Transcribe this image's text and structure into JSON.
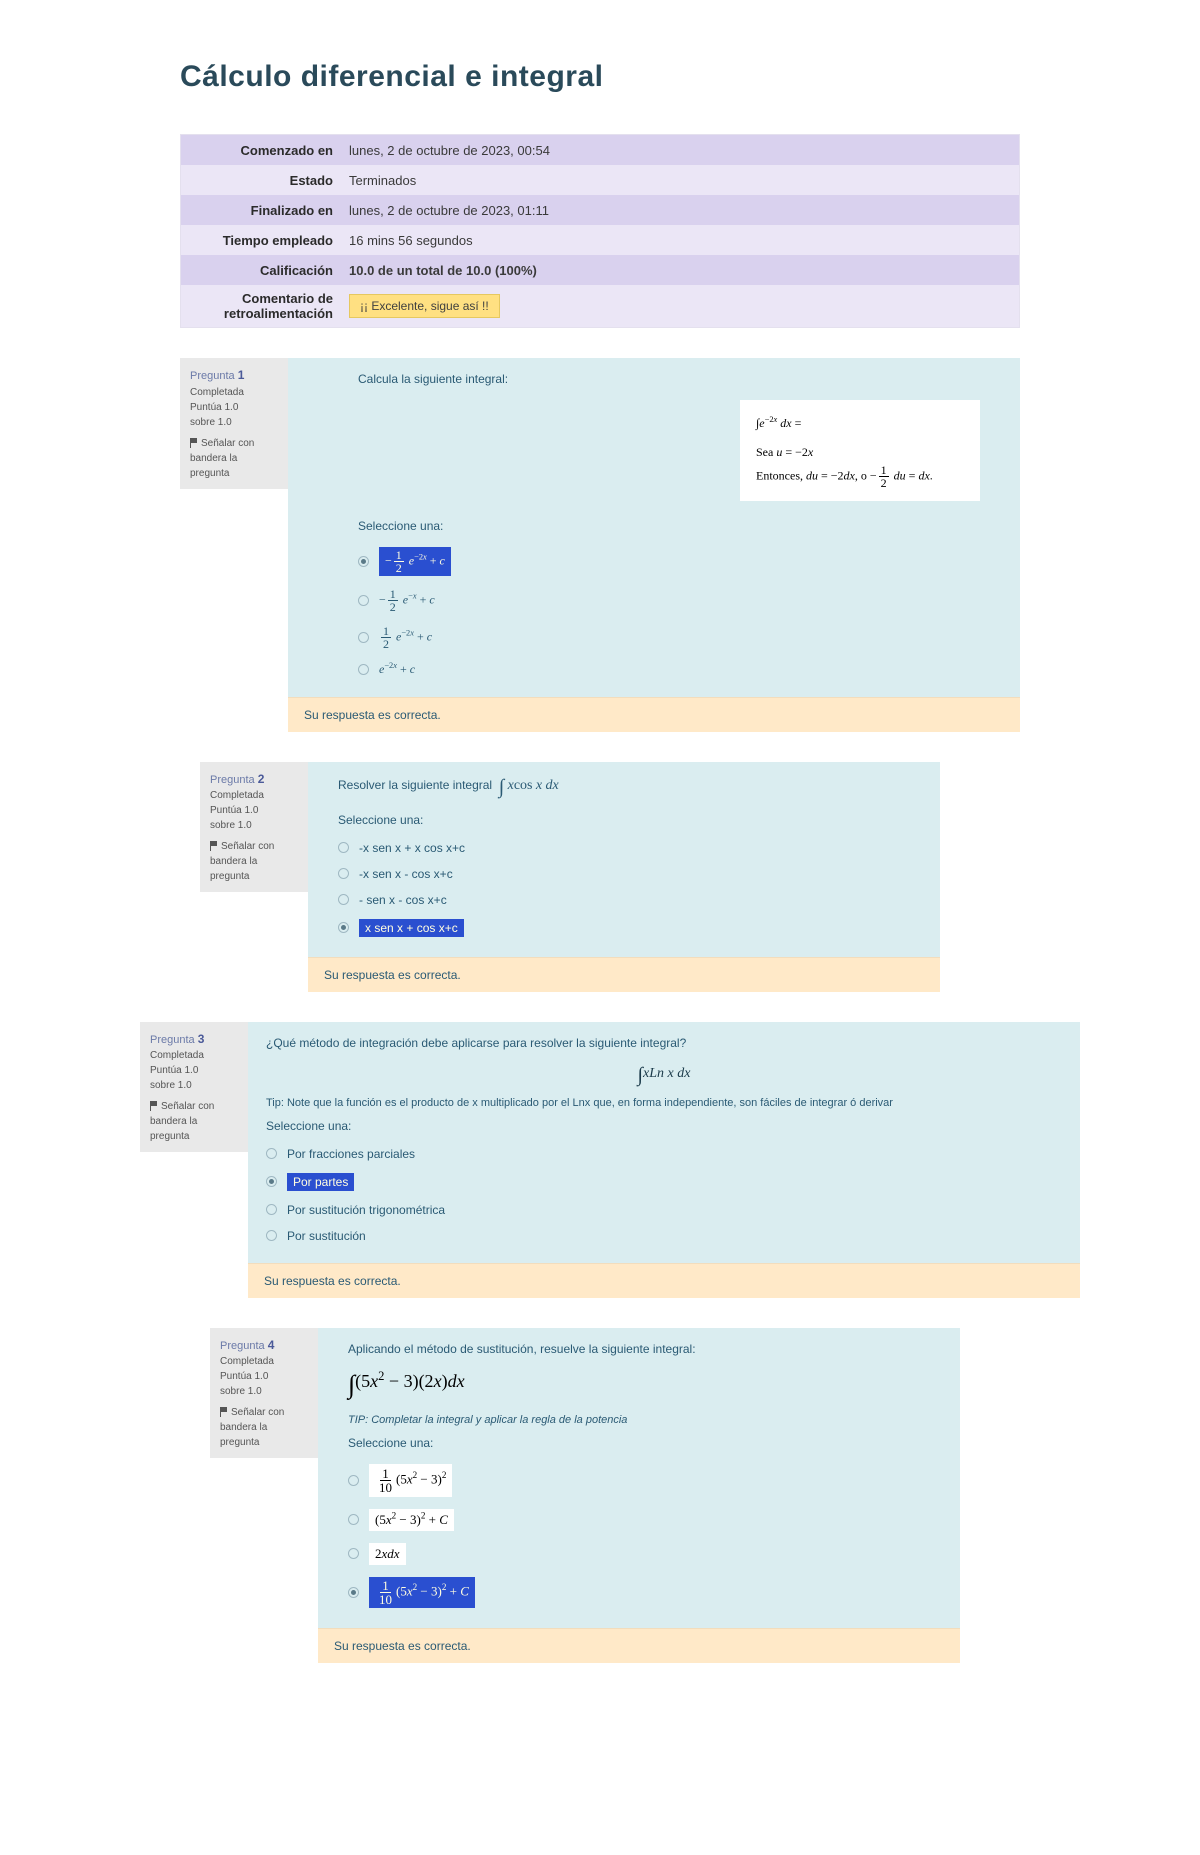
{
  "title": "Cálculo diferencial e integral",
  "summary": {
    "rows": [
      {
        "label": "Comenzado en",
        "value": "lunes, 2 de octubre de 2023, 00:54"
      },
      {
        "label": "Estado",
        "value": "Terminados"
      },
      {
        "label": "Finalizado en",
        "value": "lunes, 2 de octubre de 2023, 01:11"
      },
      {
        "label": "Tiempo empleado",
        "value": "16 mins 56 segundos"
      },
      {
        "label": "Calificación",
        "value": "10.0 de un total de 10.0 (100%)"
      }
    ],
    "feedback_label": "Comentario de retroalimentación",
    "feedback_text": "¡¡ Excelente, sigue así !!"
  },
  "common": {
    "question_word": "Pregunta",
    "completed": "Completada",
    "score_prefix": "Puntúa 1.0",
    "score_suffix": "sobre 1.0",
    "flag": "Señalar con bandera la pregunta",
    "select_one": "Seleccione una:",
    "correct": "Su respuesta es correcta."
  },
  "q1": {
    "num": "1",
    "prompt": "Calcula la siguiente integral:",
    "math": {
      "line1": "∫e^{-2x} dx =",
      "line2": "Sea u = −2x",
      "line3": "Entonces, du = −2dx, o −½ du = dx."
    },
    "options": [
      {
        "text": "−½ e^{−2x} + c",
        "selected": true,
        "highlight": true
      },
      {
        "text": "−½ e^{−x} + c",
        "selected": false,
        "highlight": false
      },
      {
        "text": "½ e^{−2x} + c",
        "selected": false,
        "highlight": false
      },
      {
        "text": "e^{−2x} + c",
        "selected": false,
        "highlight": false
      }
    ]
  },
  "q2": {
    "num": "2",
    "prompt_prefix": "Resolver la siguiente integral",
    "prompt_integral": "∫ xcos x dx",
    "options": [
      {
        "text": "-x sen x + x cos x+c",
        "selected": false,
        "highlight": false
      },
      {
        "text": "-x sen x - cos x+c",
        "selected": false,
        "highlight": false
      },
      {
        "text": "- sen x - cos x+c",
        "selected": false,
        "highlight": false
      },
      {
        "text": "x sen x + cos x+c",
        "selected": true,
        "highlight": true
      }
    ]
  },
  "q3": {
    "num": "3",
    "prompt": "¿Qué método de integración debe aplicarse para resolver la siguiente integral?",
    "formula": "∫xLn x dx",
    "tip": "Tip: Note que la función es el producto de x multiplicado por el Lnx que, en forma independiente, son fáciles de integrar ó derivar",
    "options": [
      {
        "text": "Por fracciones parciales",
        "selected": false,
        "highlight": false
      },
      {
        "text": "Por partes",
        "selected": true,
        "highlight": true
      },
      {
        "text": "Por sustitución trigonométrica",
        "selected": false,
        "highlight": false
      },
      {
        "text": "Por sustitución",
        "selected": false,
        "highlight": false
      }
    ]
  },
  "q4": {
    "num": "4",
    "prompt": "Aplicando el método de sustitución, resuelve la siguiente integral:",
    "integral": "∫ (5x² − 3)(2x)dx",
    "tip": "TIP: Completar la integral y aplicar la regla de la potencia",
    "options": [
      {
        "text": "1/10 (5x² − 3)²",
        "selected": false,
        "highlight": false
      },
      {
        "text": "(5x² − 3)² + C",
        "selected": false,
        "highlight": false
      },
      {
        "text": "2xdx",
        "selected": false,
        "highlight": false
      },
      {
        "text": "1/10 (5x² − 3)² + C",
        "selected": true,
        "highlight": true
      }
    ]
  }
}
